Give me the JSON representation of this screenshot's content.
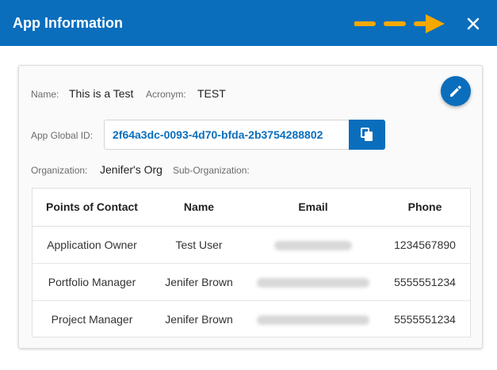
{
  "dialog": {
    "title": "App Information",
    "close_icon": "close-icon",
    "arrow_icon": "arrow-right-dashed-icon",
    "arrow_color": "#f5a800"
  },
  "card": {
    "name_label": "Name:",
    "name_value": "This is a Test",
    "acronym_label": "Acronym:",
    "acronym_value": "TEST",
    "gid_label": "App Global ID:",
    "gid_value": "2f64a3dc-0093-4d70-bfda-2b3754288802",
    "org_label": "Organization:",
    "org_value": "Jenifer's Org",
    "suborg_label": "Sub-Organization:",
    "suborg_value": ""
  },
  "contacts": {
    "headers": [
      "Points of Contact",
      "Name",
      "Email",
      "Phone"
    ],
    "rows": [
      {
        "role": "Application Owner",
        "name": "Test User",
        "email": "",
        "phone": "1234567890"
      },
      {
        "role": "Portfolio Manager",
        "name": "Jenifer Brown",
        "email": "",
        "phone": "5555551234"
      },
      {
        "role": "Project Manager",
        "name": "Jenifer Brown",
        "email": "",
        "phone": "5555551234"
      }
    ]
  },
  "colors": {
    "primary": "#0a6ebd",
    "accent": "#f5a800"
  }
}
